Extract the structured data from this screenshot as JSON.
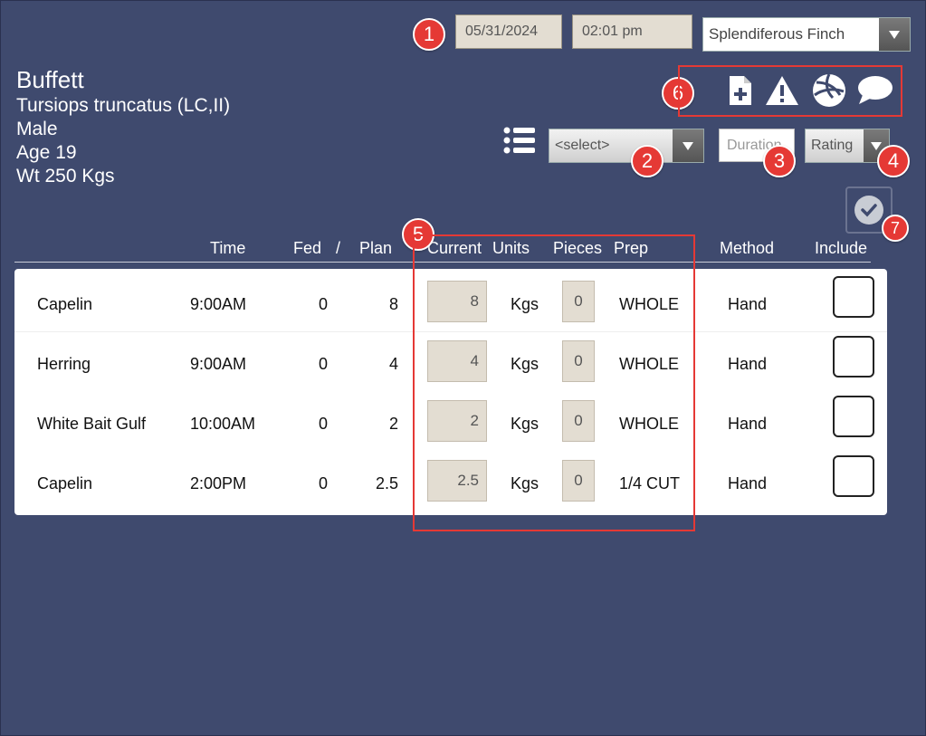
{
  "header": {
    "date": "05/31/2024",
    "time": "02:01 pm",
    "user_select": "Splendiferous Finch"
  },
  "animal": {
    "name": "Buffett",
    "species": "Tursiops truncatus (LC,II)",
    "sex": "Male",
    "age": "Age 19",
    "weight": "Wt 250 Kgs"
  },
  "controls": {
    "list_select": "<select>",
    "duration_placeholder": "Duration",
    "rating_select": "Rating"
  },
  "badges": [
    "1",
    "2",
    "3",
    "4",
    "5",
    "6",
    "7"
  ],
  "icons": [
    "new-document-icon",
    "warning-icon",
    "ball-icon",
    "comment-icon",
    "list-icon",
    "checkmark-icon"
  ],
  "table": {
    "columns": {
      "time": "Time",
      "fed": "Fed",
      "sep": "/",
      "plan": "Plan",
      "current": "Current",
      "units": "Units",
      "pieces": "Pieces",
      "prep": "Prep",
      "method": "Method",
      "include": "Include"
    },
    "rows": [
      {
        "food": "Capelin",
        "time": "9:00AM",
        "fed": "0",
        "plan": "8",
        "current": "8",
        "units": "Kgs",
        "pieces": "0",
        "prep": "WHOLE",
        "method": "Hand"
      },
      {
        "food": "Herring",
        "time": "9:00AM",
        "fed": "0",
        "plan": "4",
        "current": "4",
        "units": "Kgs",
        "pieces": "0",
        "prep": "WHOLE",
        "method": "Hand"
      },
      {
        "food": "White Bait Gulf",
        "time": "10:00AM",
        "fed": "0",
        "plan": "2",
        "current": "2",
        "units": "Kgs",
        "pieces": "0",
        "prep": "WHOLE",
        "method": "Hand"
      },
      {
        "food": "Capelin",
        "time": "2:00PM",
        "fed": "0",
        "plan": "2.5",
        "current": "2.5",
        "units": "Kgs",
        "pieces": "0",
        "prep": "1/4 CUT",
        "method": "Hand"
      }
    ]
  },
  "colors": {
    "background": "#3f4a6e",
    "callout": "#e53935",
    "input": "#e3ddd2"
  }
}
